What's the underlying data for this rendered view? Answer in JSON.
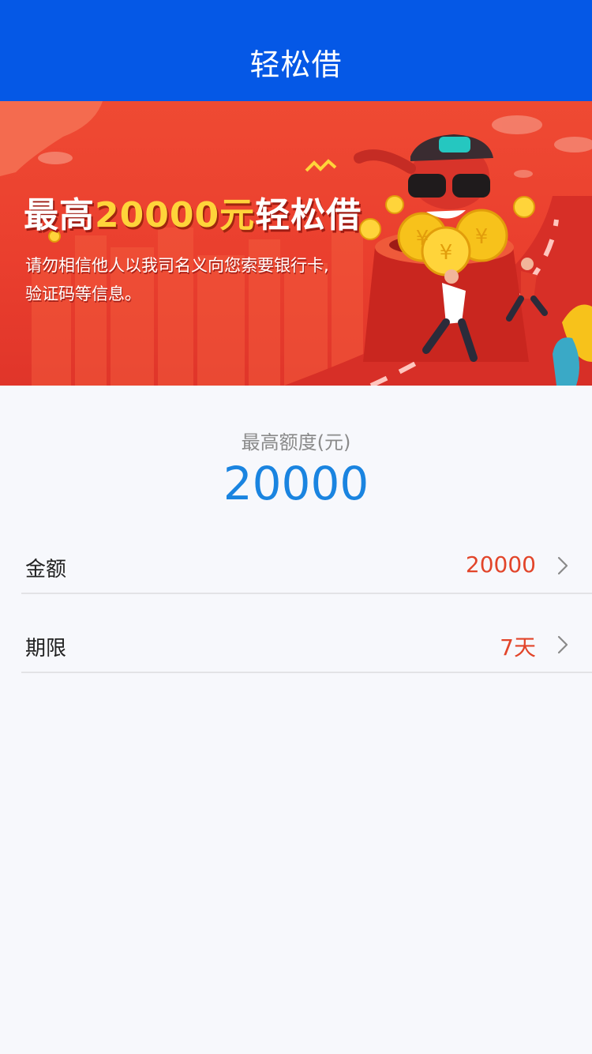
{
  "header": {
    "title": "轻松借"
  },
  "banner": {
    "headline_prefix": "最高",
    "headline_amount": "20000元",
    "headline_suffix": "轻松借",
    "notice_line1": "请勿相信他人以我司名义向您索要银行卡,",
    "notice_line2": "验证码等信息。"
  },
  "limit": {
    "label": "最高额度(元)",
    "value": "20000"
  },
  "form": {
    "amount": {
      "label": "金额",
      "value": "20000"
    },
    "term": {
      "label": "期限",
      "value": "7天"
    }
  },
  "colors": {
    "nav": "#0558e6",
    "banner_red": "#ea3f2e",
    "limit_blue": "#1a84e0",
    "value_red": "#e2452a"
  },
  "icons": [
    "chevron-right-icon",
    "coin-icon",
    "cloud-icon"
  ]
}
